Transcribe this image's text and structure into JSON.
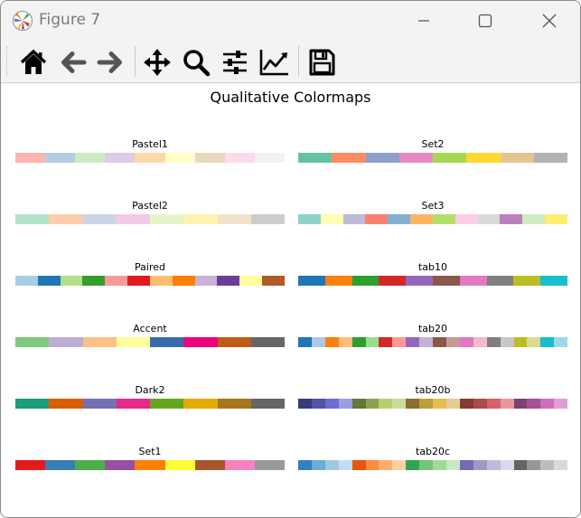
{
  "window": {
    "title": "Figure 7",
    "buttons": [
      "minimize",
      "maximize",
      "close"
    ]
  },
  "toolbar": {
    "buttons": [
      {
        "name": "home-button",
        "icon": "home-icon"
      },
      {
        "name": "back-button",
        "icon": "arrow-left-icon"
      },
      {
        "name": "forward-button",
        "icon": "arrow-right-icon"
      },
      {
        "name": "pan-button",
        "icon": "move-icon"
      },
      {
        "name": "zoom-button",
        "icon": "magnifier-icon"
      },
      {
        "name": "configure-subplots-button",
        "icon": "sliders-icon"
      },
      {
        "name": "edit-axes-button",
        "icon": "line-chart-icon"
      },
      {
        "name": "save-button",
        "icon": "floppy-disk-icon"
      }
    ]
  },
  "figure": {
    "title": "Qualitative Colormaps",
    "colormaps": [
      {
        "name": "Pastel1",
        "colors": [
          "#fbb4ae",
          "#b3cde3",
          "#ccebc5",
          "#decbe4",
          "#fed9a6",
          "#ffffcc",
          "#e5d8bd",
          "#fddaec",
          "#f2f2f2"
        ]
      },
      {
        "name": "Set2",
        "colors": [
          "#66c2a5",
          "#fc8d62",
          "#8da0cb",
          "#e78ac3",
          "#a6d854",
          "#ffd92f",
          "#e5c494",
          "#b3b3b3"
        ]
      },
      {
        "name": "Pastel2",
        "colors": [
          "#b3e2cd",
          "#fdcdac",
          "#cbd5e8",
          "#f4cae4",
          "#e6f5c9",
          "#fff2ae",
          "#f1e2cc",
          "#cccccc"
        ]
      },
      {
        "name": "Set3",
        "colors": [
          "#8dd3c7",
          "#ffffb3",
          "#bebada",
          "#fb8072",
          "#80b1d3",
          "#fdb462",
          "#b3de69",
          "#fccde5",
          "#d9d9d9",
          "#bc80bd",
          "#ccebc5",
          "#ffed6f"
        ]
      },
      {
        "name": "Paired",
        "colors": [
          "#a6cee3",
          "#1f78b4",
          "#b2df8a",
          "#33a02c",
          "#fb9a99",
          "#e31a1c",
          "#fdbf6f",
          "#ff7f00",
          "#cab2d6",
          "#6a3d9a",
          "#ffff99",
          "#b15928"
        ]
      },
      {
        "name": "tab10",
        "colors": [
          "#1f77b4",
          "#ff7f0e",
          "#2ca02c",
          "#d62728",
          "#9467bd",
          "#8c564b",
          "#e377c2",
          "#7f7f7f",
          "#bcbd22",
          "#17becf"
        ]
      },
      {
        "name": "Accent",
        "colors": [
          "#7fc97f",
          "#beaed4",
          "#fdc086",
          "#ffff99",
          "#386cb0",
          "#f0027f",
          "#bf5b17",
          "#666666"
        ]
      },
      {
        "name": "tab20",
        "colors": [
          "#1f77b4",
          "#aec7e8",
          "#ff7f0e",
          "#ffbb78",
          "#2ca02c",
          "#98df8a",
          "#d62728",
          "#ff9896",
          "#9467bd",
          "#c5b0d5",
          "#8c564b",
          "#c49c94",
          "#e377c2",
          "#f7b6d2",
          "#7f7f7f",
          "#c7c7c7",
          "#bcbd22",
          "#dbdb8d",
          "#17becf",
          "#9edae5"
        ]
      },
      {
        "name": "Dark2",
        "colors": [
          "#1b9e77",
          "#d95f02",
          "#7570b3",
          "#e7298a",
          "#66a61e",
          "#e6ab02",
          "#a6761d",
          "#666666"
        ]
      },
      {
        "name": "tab20b",
        "colors": [
          "#393b79",
          "#5254a3",
          "#6b6ecf",
          "#9c9ede",
          "#637939",
          "#8ca252",
          "#b5cf6b",
          "#cedb9c",
          "#8c6d31",
          "#bd9e39",
          "#e7ba52",
          "#e7cb94",
          "#843c39",
          "#ad494a",
          "#d6616b",
          "#e7969c",
          "#7b4173",
          "#a55194",
          "#ce6dbd",
          "#de9ed6"
        ]
      },
      {
        "name": "Set1",
        "colors": [
          "#e41a1c",
          "#377eb8",
          "#4daf4a",
          "#984ea3",
          "#ff7f00",
          "#ffff33",
          "#a65628",
          "#f781bf",
          "#999999"
        ]
      },
      {
        "name": "tab20c",
        "colors": [
          "#3182bd",
          "#6baed6",
          "#9ecae1",
          "#c6dbef",
          "#e6550d",
          "#fd8d3c",
          "#fdae6b",
          "#fdd0a2",
          "#31a354",
          "#74c476",
          "#a1d99b",
          "#c7e9c0",
          "#756bb1",
          "#9e9ac8",
          "#bcbddc",
          "#dadaeb",
          "#636363",
          "#969696",
          "#bdbdbd",
          "#d9d9d9"
        ]
      }
    ]
  }
}
